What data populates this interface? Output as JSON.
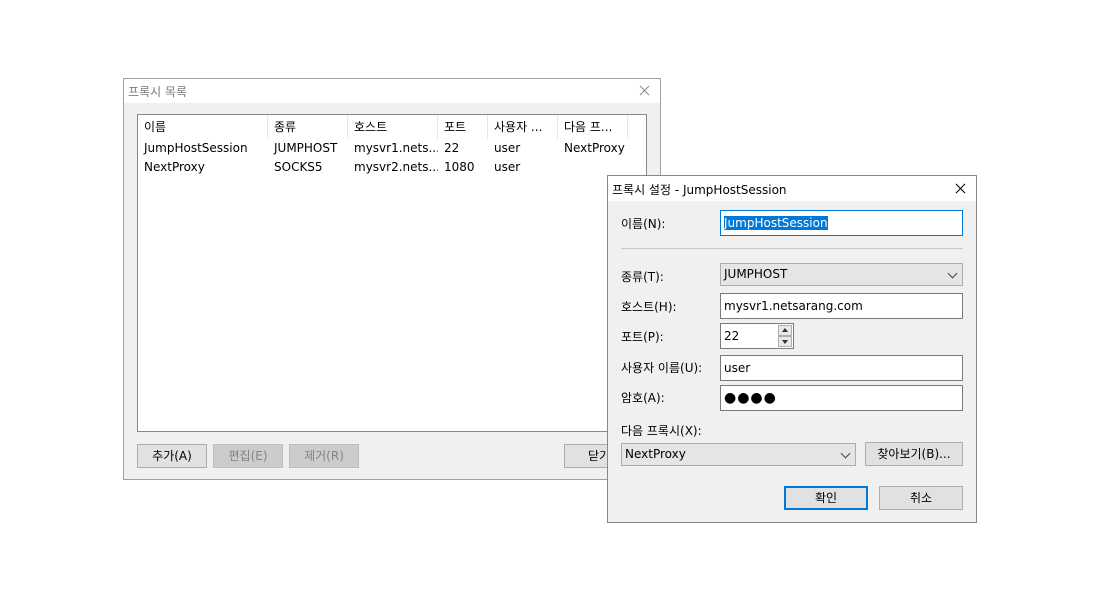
{
  "list_window": {
    "title": "프록시 목록",
    "columns": [
      "이름",
      "종류",
      "호스트",
      "포트",
      "사용자 ...",
      "다음 프..."
    ],
    "rows": [
      [
        "JumpHostSession",
        "JUMPHOST",
        "mysvr1.nets...",
        "22",
        "user",
        "NextProxy"
      ],
      [
        "NextProxy",
        "SOCKS5",
        "mysvr2.nets...",
        "1080",
        "user",
        ""
      ]
    ],
    "buttons": {
      "add": "추가(A)",
      "edit": "편집(E)",
      "remove": "제거(R)",
      "close": "닫기"
    }
  },
  "settings_dialog": {
    "title": "프록시 설정 - JumpHostSession",
    "name_label": "이름(N):",
    "name_value": "JumpHostSession",
    "type_label": "종류(T):",
    "type_value": "JUMPHOST",
    "host_label": "호스트(H):",
    "host_value": "mysvr1.netsarang.com",
    "port_label": "포트(P):",
    "port_value": "22",
    "user_label": "사용자 이름(U):",
    "user_value": "user",
    "password_label": "암호(A):",
    "password_mask": "●●●●",
    "next_proxy_label": "다음 프록시(X):",
    "next_proxy_value": "NextProxy",
    "browse_button": "찾아보기(B)...",
    "ok_button": "확인",
    "cancel_button": "취소"
  },
  "colors": {
    "accent": "#0078d7",
    "window_bg": "#f0f0f0"
  }
}
